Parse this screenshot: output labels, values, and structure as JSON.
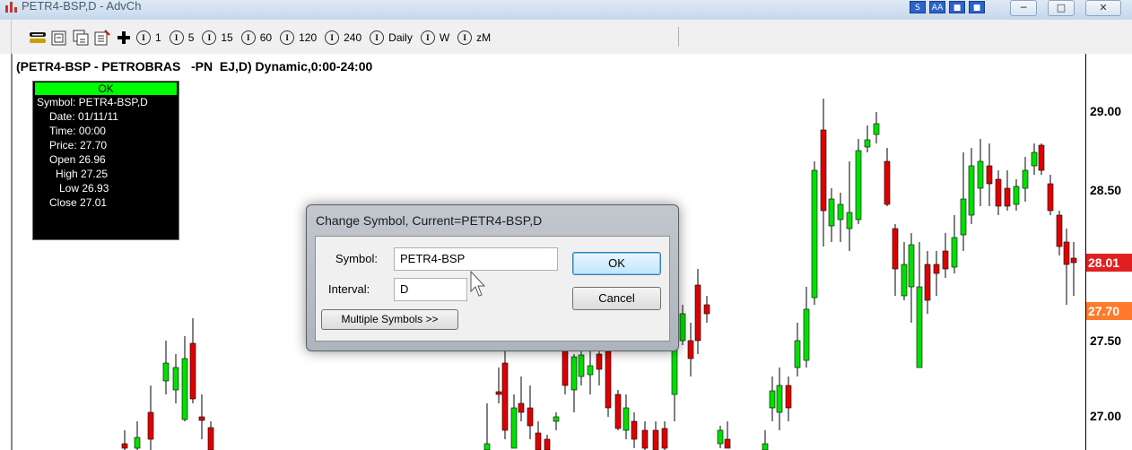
{
  "window": {
    "title": "PETR4-BSP,D - AdvCh",
    "mini_icons": [
      "S",
      "AA",
      "■",
      "■"
    ],
    "controls": {
      "minimize": "─",
      "maximize": "□",
      "close": "✕"
    }
  },
  "toolbar": {
    "tool_icons": [
      "link-chain-icon",
      "refresh-chart-icon",
      "copy-chart-icon",
      "properties-icon",
      "crosshair-plus-icon"
    ],
    "intervals": [
      {
        "label": "1"
      },
      {
        "label": "5"
      },
      {
        "label": "15"
      },
      {
        "label": "60"
      },
      {
        "label": "120"
      },
      {
        "label": "240"
      },
      {
        "label": "Daily"
      },
      {
        "label": "W"
      },
      {
        "label": "zM"
      }
    ]
  },
  "chart": {
    "header": "(PETR4-BSP - PETROBRAS   -PN  EJ,D) Dynamic,0:00-24:00",
    "price_axis": [
      "29.00",
      "28.50",
      "27.50",
      "27.00"
    ],
    "last_price_tag": {
      "text": "28.01",
      "color": "#e02020"
    },
    "current_price_tag": {
      "text": "27.70",
      "color": "#ff7a2b"
    },
    "up_color": "#00e000",
    "down_color": "#e00000"
  },
  "data_window": {
    "status": "OK",
    "rows": [
      "Symbol: PETR4-BSP,D",
      "Date: 01/11/11",
      "Time: 00:00",
      "Price: 27.70",
      "Open 26.96",
      "High 27.25",
      "Low 26.93",
      "Close 27.01"
    ]
  },
  "dialog": {
    "title": "Change Symbol, Current=PETR4-BSP,D",
    "symbol_label": "Symbol:",
    "symbol_value": "PETR4-BSP",
    "interval_label": "Interval:",
    "interval_value": "D",
    "multiple_symbols_label": "Multiple Symbols >>",
    "ok_label": "OK",
    "cancel_label": "Cancel"
  }
}
